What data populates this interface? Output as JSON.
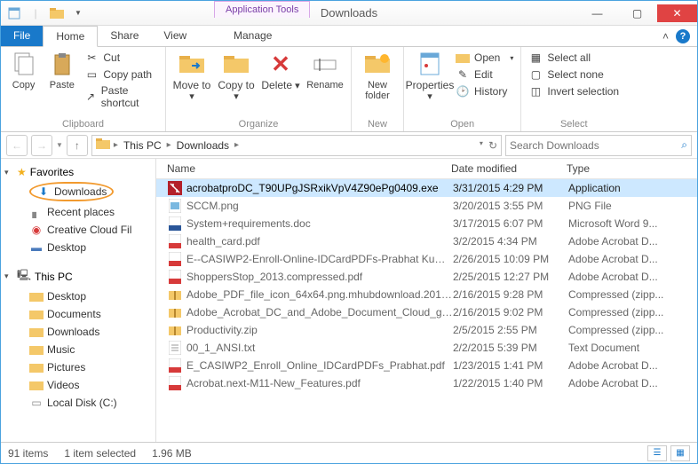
{
  "window": {
    "title": "Downloads",
    "tools_label": "Application Tools"
  },
  "tabs": {
    "file": "File",
    "home": "Home",
    "share": "Share",
    "view": "View",
    "manage": "Manage"
  },
  "ribbon": {
    "clipboard": {
      "label": "Clipboard",
      "copy": "Copy",
      "paste": "Paste",
      "cut": "Cut",
      "copy_path": "Copy path",
      "paste_shortcut": "Paste shortcut"
    },
    "organize": {
      "label": "Organize",
      "move_to": "Move to",
      "copy_to": "Copy to",
      "delete": "Delete",
      "rename": "Rename"
    },
    "new": {
      "label": "New",
      "new_folder": "New folder"
    },
    "open": {
      "label": "Open",
      "properties": "Properties",
      "open": "Open",
      "edit": "Edit",
      "history": "History"
    },
    "select": {
      "label": "Select",
      "select_all": "Select all",
      "select_none": "Select none",
      "invert": "Invert selection"
    }
  },
  "breadcrumb": {
    "this_pc": "This PC",
    "downloads": "Downloads"
  },
  "search": {
    "placeholder": "Search Downloads"
  },
  "sidebar": {
    "favorites": "Favorites",
    "downloads": "Downloads",
    "recent": "Recent places",
    "creative": "Creative Cloud Fil",
    "desktop": "Desktop",
    "this_pc": "This PC",
    "pc_desktop": "Desktop",
    "pc_documents": "Documents",
    "pc_downloads": "Downloads",
    "pc_music": "Music",
    "pc_pictures": "Pictures",
    "pc_videos": "Videos",
    "pc_localdisk": "Local Disk (C:)"
  },
  "columns": {
    "name": "Name",
    "date": "Date modified",
    "type": "Type"
  },
  "files": [
    {
      "name": "acrobatproDC_T90UPgJSRxikVpV4Z90ePg0409.exe",
      "date": "3/31/2015 4:29 PM",
      "type": "Application",
      "icon": "exe",
      "selected": true
    },
    {
      "name": "SCCM.png",
      "date": "3/20/2015 3:55 PM",
      "type": "PNG File",
      "icon": "img"
    },
    {
      "name": "System+requirements.doc",
      "date": "3/17/2015 6:07 PM",
      "type": "Microsoft Word 9...",
      "icon": "doc"
    },
    {
      "name": "health_card.pdf",
      "date": "3/2/2015 4:34 PM",
      "type": "Adobe Acrobat D...",
      "icon": "pdf"
    },
    {
      "name": "E--CASIWP2-Enroll-Online-IDCardPDFs-Prabhat Kuma...",
      "date": "2/26/2015 10:09 PM",
      "type": "Adobe Acrobat D...",
      "icon": "pdf"
    },
    {
      "name": "ShoppersStop_2013.compressed.pdf",
      "date": "2/25/2015 12:27 PM",
      "type": "Adobe Acrobat D...",
      "icon": "pdf"
    },
    {
      "name": "Adobe_PDF_file_icon_64x64.png.mhubdownload.20150...",
      "date": "2/16/2015 9:28 PM",
      "type": "Compressed (zipp...",
      "icon": "zip"
    },
    {
      "name": "Adobe_Acrobat_DC_and_Adobe_Document_Cloud_gui...",
      "date": "2/16/2015 9:02 PM",
      "type": "Compressed (zipp...",
      "icon": "zip"
    },
    {
      "name": "Productivity.zip",
      "date": "2/5/2015 2:55 PM",
      "type": "Compressed (zipp...",
      "icon": "zip"
    },
    {
      "name": "00_1_ANSI.txt",
      "date": "2/2/2015 5:39 PM",
      "type": "Text Document",
      "icon": "txt"
    },
    {
      "name": "E_CASIWP2_Enroll_Online_IDCardPDFs_Prabhat.pdf",
      "date": "1/23/2015 1:41 PM",
      "type": "Adobe Acrobat D...",
      "icon": "pdf"
    },
    {
      "name": "Acrobat.next-M11-New_Features.pdf",
      "date": "1/22/2015 1:40 PM",
      "type": "Adobe Acrobat D...",
      "icon": "pdf"
    }
  ],
  "status": {
    "items": "91 items",
    "selected": "1 item selected",
    "size": "1.96 MB"
  }
}
